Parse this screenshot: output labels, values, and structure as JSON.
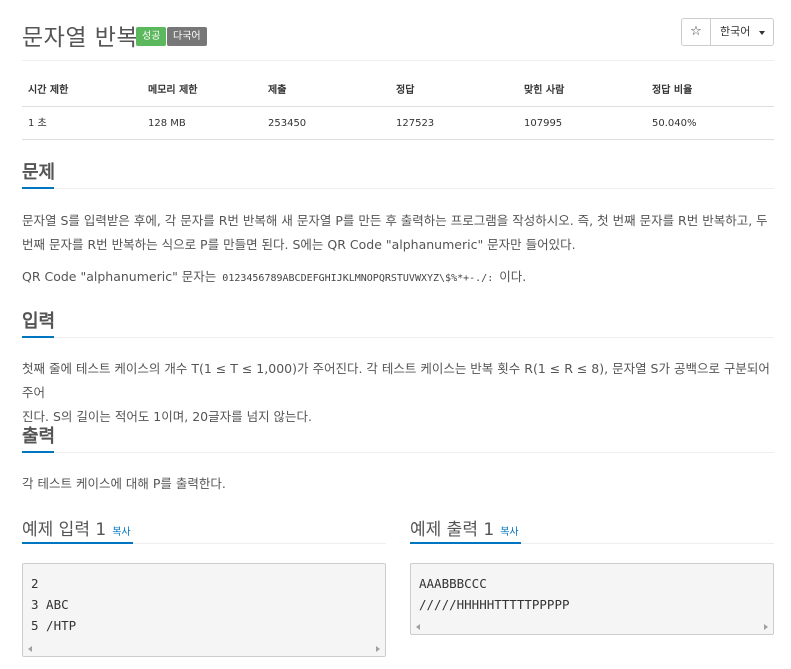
{
  "header": {
    "title": "문자열 반복",
    "badge_status": "성공",
    "badge_lang": "다국어",
    "star_icon": "☆",
    "language_label": "한국어"
  },
  "stats": {
    "headers": [
      "시간 제한",
      "메모리 제한",
      "제출",
      "정답",
      "맞힌 사람",
      "정답 비율"
    ],
    "values": [
      "1 초",
      "128 MB",
      "253450",
      "127523",
      "107995",
      "50.040%"
    ]
  },
  "problem": {
    "heading": "문제",
    "p1_line1": "문자열 S를 입력받은 후에, 각 문자를 R번 반복해 새 문자열 P를 만든 후 출력하는 프로그램을 작성하시오. 즉, 첫 번째 문자를 R번 반복하고, 두",
    "p1_line2": "번째 문자를 R번 반복하는 식으로 P를 만들면 된다. S에는 QR Code \"alphanumeric\" 문자만 들어있다.",
    "p2_prefix": "QR Code \"alphanumeric\" 문자는",
    "p2_code": "0123456789ABCDEFGHIJKLMNOPQRSTUVWXYZ\\$%*+-./:",
    "p2_suffix": "이다."
  },
  "input": {
    "heading": "입력",
    "line1": "첫째 줄에 테스트 케이스의 개수 T(1 ≤ T ≤ 1,000)가 주어진다. 각 테스트 케이스는 반복 횟수 R(1 ≤ R ≤ 8), 문자열 S가 공백으로 구분되어 주어",
    "line2": "진다. S의 길이는 적어도 1이며, 20글자를 넘지 않는다."
  },
  "output": {
    "heading": "출력",
    "line1": "각 테스트 케이스에 대해 P를 출력한다."
  },
  "examples": {
    "input_title": "예제 입력 1",
    "output_title": "예제 출력 1",
    "copy_label": "복사",
    "input_lines": [
      "2",
      "3 ABC",
      "5 /HTP"
    ],
    "output_lines": [
      "AAABBBCCC",
      "/////HHHHHTTTTTPPPPP"
    ]
  },
  "colors": {
    "accent": "#0076c0",
    "success": "#5cb85c",
    "lang_badge": "#777777"
  }
}
